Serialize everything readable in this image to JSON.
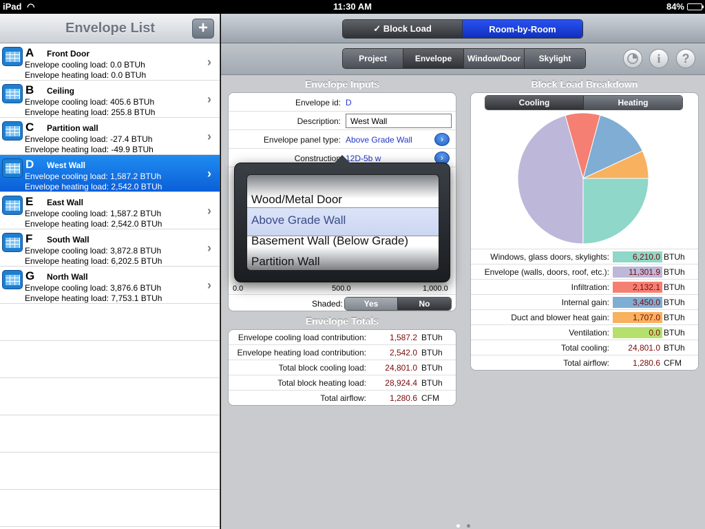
{
  "status": {
    "carrier": "iPad",
    "time": "11:30 AM",
    "battery": "84%",
    "battery_level": 0.84
  },
  "left": {
    "title": "Envelope List",
    "add_label": "+",
    "items": [
      {
        "letter": "A",
        "name": "Front Door",
        "cooling": "Envelope cooling load: 0.0 BTUh",
        "heating": "Envelope heating load: 0.0 BTUh",
        "selected": false
      },
      {
        "letter": "B",
        "name": "Ceiling",
        "cooling": "Envelope cooling load: 405.6 BTUh",
        "heating": "Envelope heating load: 255.8 BTUh",
        "selected": false
      },
      {
        "letter": "C",
        "name": "Partition wall",
        "cooling": "Envelope cooling load: -27.4 BTUh",
        "heating": "Envelope heating load: -49.9 BTUh",
        "selected": false
      },
      {
        "letter": "D",
        "name": "West Wall",
        "cooling": "Envelope cooling load: 1,587.2 BTUh",
        "heating": "Envelope heating load: 2,542.0 BTUh",
        "selected": true
      },
      {
        "letter": "E",
        "name": "East Wall",
        "cooling": "Envelope cooling load: 1,587.2 BTUh",
        "heating": "Envelope heating load: 2,542.0 BTUh",
        "selected": false
      },
      {
        "letter": "F",
        "name": "South Wall",
        "cooling": "Envelope cooling load: 3,872.8 BTUh",
        "heating": "Envelope heating load: 6,202.5 BTUh",
        "selected": false
      },
      {
        "letter": "G",
        "name": "North Wall",
        "cooling": "Envelope cooling load: 3,876.6 BTUh",
        "heating": "Envelope heating load: 7,753.1 BTUh",
        "selected": false
      }
    ]
  },
  "mode_tabs": {
    "block_load": "✓ Block Load",
    "room_by_room": "Room-by-Room"
  },
  "tabs": {
    "project": "Project",
    "envelope": "Envelope",
    "window_door": "Window/Door",
    "skylight": "Skylight"
  },
  "toolbar": {
    "info_label": "i",
    "help_label": "?"
  },
  "inputs": {
    "title": "Envelope Inputs",
    "id_label": "Envelope id:",
    "id_value": "D",
    "desc_label": "Description:",
    "desc_value": "West Wall",
    "panel_label": "Envelope panel type:",
    "panel_value": "Above Grade Wall",
    "construction_label": "Construction",
    "construction_value": "12D-5b w",
    "disclosure": "›",
    "slider_min": "0.0",
    "slider_mid": "500.0",
    "slider_max": "1,000.0",
    "shaded_label": "Shaded:",
    "shaded_yes": "Yes",
    "shaded_no": "No"
  },
  "picker": {
    "options": [
      "Wood/Metal Door",
      "Above Grade Wall",
      "Basement Wall (Below Grade)",
      "Partition Wall"
    ],
    "selected": "Above Grade Wall"
  },
  "totals": {
    "title": "Envelope Totals",
    "rows": [
      {
        "label": "Envelope cooling load contribution:",
        "value": "1,587.2",
        "unit": "BTUh"
      },
      {
        "label": "Envelope heating load contribution:",
        "value": "2,542.0",
        "unit": "BTUh"
      },
      {
        "label": "Total block cooling load:",
        "value": "24,801.0",
        "unit": "BTUh"
      },
      {
        "label": "Total block heating load:",
        "value": "28,924.4",
        "unit": "BTUh"
      },
      {
        "label": "Total airflow:",
        "value": "1,280.6",
        "unit": "CFM"
      }
    ]
  },
  "breakdown": {
    "title": "Block Load Breakdown",
    "seg_cooling": "Cooling",
    "seg_heating": "Heating",
    "rows": [
      {
        "label": "Windows, glass doors, skylights:",
        "value": "6,210.0",
        "unit": "BTUh",
        "color": "#8fd7c8"
      },
      {
        "label": "Envelope (walls, doors, roof, etc.):",
        "value": "11,301.9",
        "unit": "BTUh",
        "color": "#bdb7d9"
      },
      {
        "label": "Infiltration:",
        "value": "2,132.1",
        "unit": "BTUh",
        "color": "#f47f72"
      },
      {
        "label": "Internal gain:",
        "value": "3,450.0",
        "unit": "BTUh",
        "color": "#7fadd3"
      },
      {
        "label": "Duct and blower heat gain:",
        "value": "1,707.0",
        "unit": "BTUh",
        "color": "#f8b15f"
      },
      {
        "label": "Ventilation:",
        "value": "0.0",
        "unit": "BTUh",
        "color": "#b5e06c"
      },
      {
        "label": "Total cooling:",
        "value": "24,801.0",
        "unit": "BTUh",
        "color": ""
      },
      {
        "label": "Total airflow:",
        "value": "1,280.6",
        "unit": "CFM",
        "color": ""
      }
    ]
  },
  "chart_data": {
    "type": "pie",
    "categories": [
      "Windows, glass doors, skylights",
      "Envelope (walls, doors, roof, etc.)",
      "Infiltration",
      "Internal gain",
      "Duct and blower heat gain",
      "Ventilation"
    ],
    "values": [
      6210.0,
      11301.9,
      2132.1,
      3450.0,
      1707.0,
      0.0
    ],
    "colors": [
      "#8fd7c8",
      "#bdb7d9",
      "#f47f72",
      "#7fadd3",
      "#f8b15f",
      "#b5e06c"
    ]
  }
}
